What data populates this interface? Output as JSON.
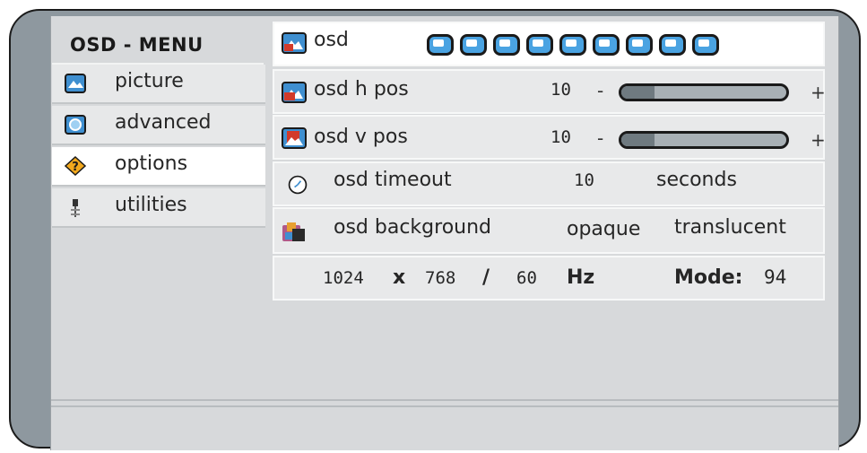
{
  "menu": {
    "title": "OSD - MENU",
    "items": [
      {
        "label": "picture",
        "icon": "picture-icon",
        "selected": false
      },
      {
        "label": "advanced",
        "icon": "advanced-icon",
        "selected": false
      },
      {
        "label": "options",
        "icon": "options-icon",
        "selected": true
      },
      {
        "label": "utilities",
        "icon": "utilities-icon",
        "selected": false
      }
    ]
  },
  "options": {
    "osd": {
      "label": "osd",
      "segments": 9,
      "icon": "osd-icon"
    },
    "h_pos": {
      "label": "osd h pos",
      "value": "10",
      "minus": "-",
      "plus": "+",
      "level": 0.2,
      "icon": "osd-h-pos-icon"
    },
    "v_pos": {
      "label": "osd v pos",
      "value": "10",
      "minus": "-",
      "plus": "+",
      "level": 0.2,
      "icon": "osd-v-pos-icon"
    },
    "timeout": {
      "label": "osd timeout",
      "value": "10",
      "unit": "seconds",
      "icon": "clock-icon"
    },
    "background": {
      "label": "osd background",
      "opt1": "opaque",
      "opt2": "translucent",
      "icon": "background-icon"
    }
  },
  "status": {
    "width": "1024",
    "x": "x",
    "height": "768",
    "slash": "/",
    "refresh": "60",
    "hz": "Hz",
    "mode_label": "Mode:",
    "mode_value": "94"
  },
  "colors": {
    "accent": "#4aa3e2",
    "frame": "#8e989f",
    "panel": "#d7d9db"
  }
}
